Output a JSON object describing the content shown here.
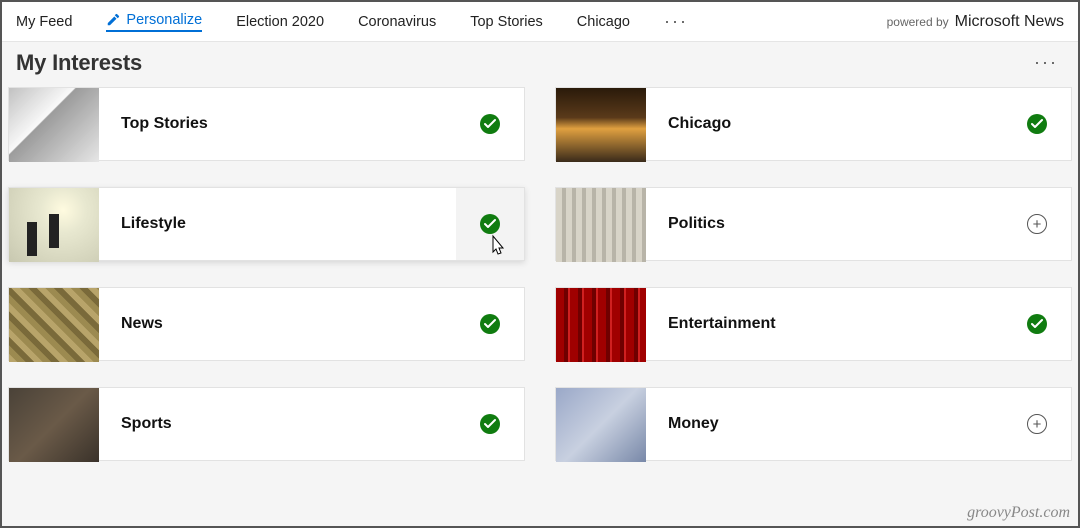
{
  "tabs": [
    {
      "label": "My Feed"
    },
    {
      "label": "Personalize",
      "active": true,
      "icon": "pencil"
    },
    {
      "label": "Election 2020"
    },
    {
      "label": "Coronavirus"
    },
    {
      "label": "Top Stories"
    },
    {
      "label": "Chicago"
    }
  ],
  "powered_by_prefix": "powered by",
  "powered_by_brand": "Microsoft News",
  "page_title": "My Interests",
  "interests": [
    {
      "label": "Top Stories",
      "selected": true,
      "thumb": "th-top-stories"
    },
    {
      "label": "Chicago",
      "selected": true,
      "thumb": "th-chicago"
    },
    {
      "label": "Lifestyle",
      "selected": true,
      "thumb": "th-lifestyle",
      "hover": true
    },
    {
      "label": "Politics",
      "selected": false,
      "thumb": "th-politics"
    },
    {
      "label": "News",
      "selected": true,
      "thumb": "th-news"
    },
    {
      "label": "Entertainment",
      "selected": true,
      "thumb": "th-entertainment"
    },
    {
      "label": "Sports",
      "selected": true,
      "thumb": "th-sports"
    },
    {
      "label": "Money",
      "selected": false,
      "thumb": "th-money"
    }
  ],
  "colors": {
    "accent": "#006fd6",
    "selected": "#107c10"
  },
  "watermark": "groovyPost.com"
}
